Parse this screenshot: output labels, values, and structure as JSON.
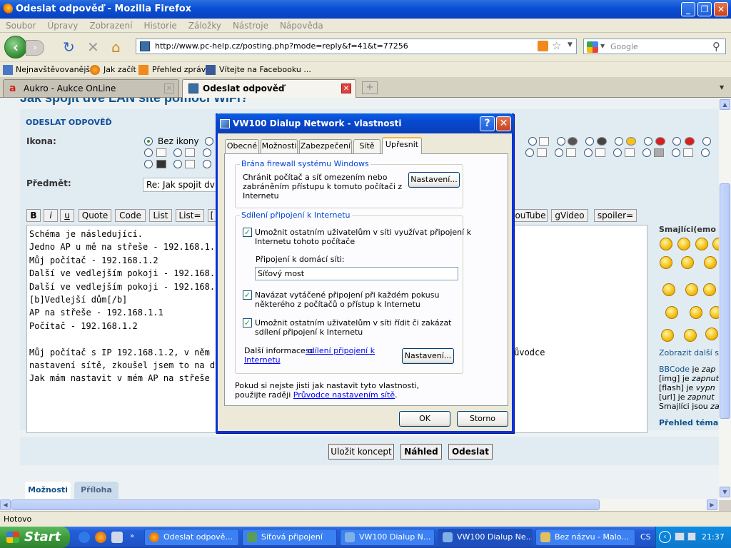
{
  "window": {
    "title": "Odeslat odpověď - Mozilla Firefox"
  },
  "menu": [
    "Soubor",
    "Úpravy",
    "Zobrazení",
    "Historie",
    "Záložky",
    "Nástroje",
    "Nápověda"
  ],
  "nav": {
    "url": "http://www.pc-help.cz/posting.php?mode=reply&f=41&t=77256",
    "search_placeholder": "Google"
  },
  "bookmarks": [
    "Nejnavštěvovanější",
    "Jak začít",
    "Přehled zpráv",
    "Vítejte na Facebooku ..."
  ],
  "tabs": [
    {
      "label": "Aukro - Aukce OnLine"
    },
    {
      "label": "Odeslat odpověď"
    }
  ],
  "page": {
    "heading": "Jak spojit dvě LAN sítě pomocí WiFi?",
    "panel_title": "ODESLAT ODPOVĚĎ",
    "icon_label": "Ikona:",
    "no_icon": "Bez ikony",
    "subject_label": "Předmět:",
    "subject_value": "Re: Jak spojit dv",
    "bbcode": [
      "B",
      "i",
      "u",
      "Quote",
      "Code",
      "List",
      "List=",
      "[",
      "ouTube",
      "gVideo",
      "spoiler="
    ],
    "message": "Schéma je následující.\nJedno AP u mě na střeše - 192.168.1.1\nMůj počítač - 192.168.1.2\nDalší ve vedlejším pokoji - 192.168.1.3\nDalší ve vedlejším pokoji - 192.168.1.4\n[b]Vedlejší dům[/b]\nAP na střeše - 192.168.1.1\nPočítač - 192.168.1.2\n\nMůj počítač s IP 192.168.1.2, v něm je 3G m                                    Nepomáhá ani průvodce\nnastavení sítě, zkoušel jsem to na dvou počí                                   ckou IP z DHCP.\nJak mám nastavit v mém AP na střeše bránu",
    "smileys_title": "Smajlíci(emo",
    "show_more": "Zobrazit další s",
    "bbcode_info": [
      {
        "pre": "BBCode",
        "mid": " je ",
        "post": "zap"
      },
      {
        "pre": "[img]",
        "mid": " je ",
        "post": "zapnut"
      },
      {
        "pre": "[flash]",
        "mid": " je ",
        "post": "vypn"
      },
      {
        "pre": "[url]",
        "mid": " je ",
        "post": "zapnut"
      },
      {
        "pre": "Smajlíci jsou",
        "mid": " ",
        "post": "za"
      }
    ],
    "topic_overview": "Přehled téma",
    "buttons": {
      "save": "Uložit koncept",
      "preview": "Náhled",
      "submit": "Odeslat"
    },
    "bottom_tabs": [
      "Možnosti",
      "Příloha"
    ]
  },
  "status": "Hotovo",
  "taskbar": {
    "start": "Start",
    "items": [
      "Odeslat odpově...",
      "Síťová připojení",
      "VW100 Dialup N...",
      "VW100 Dialup Ne...",
      "Bez názvu - Malo..."
    ],
    "lang": "CS",
    "clock": "21:37"
  },
  "dialog": {
    "title": "VW100 Dialup Network - vlastnosti",
    "tabs": [
      "Obecné",
      "Možnosti",
      "Zabezpečení",
      "Sítě",
      "Upřesnit"
    ],
    "firewall_group": "Brána firewall systému Windows",
    "firewall_text": "Chránit počítač a síť omezením nebo\nzabráněním přístupu k tomuto počítači z\nInternetu",
    "firewall_button": "Nastavení...",
    "ics_group": "Sdílení připojení k Internetu",
    "ics_allow": "Umožnit ostatním uživatelům v síti využívat připojení k\nInternetu tohoto počítače",
    "home_net_label": "Připojení k domácí síti:",
    "home_net_value": "Síťový most",
    "ics_dial": "Navázat vytáčené připojení při každém pokusu\nněkterého z počítačů o přístup k Internetu",
    "ics_control": "Umožnit ostatním uživatelům v síti řídit či zakázat\nsdílení připojení k Internetu",
    "more_info": "Další informace o ",
    "more_info_link": "sdílení připojení k\nInternetu",
    "ics_button": "Nastavení...",
    "unsure_text": "Pokud si nejste jisti jak nastavit tyto vlastnosti,\npoužijte raději ",
    "wizard_link": "Průvodce nastavením sítě",
    "wizard_end": ".",
    "ok": "OK",
    "cancel": "Storno"
  }
}
